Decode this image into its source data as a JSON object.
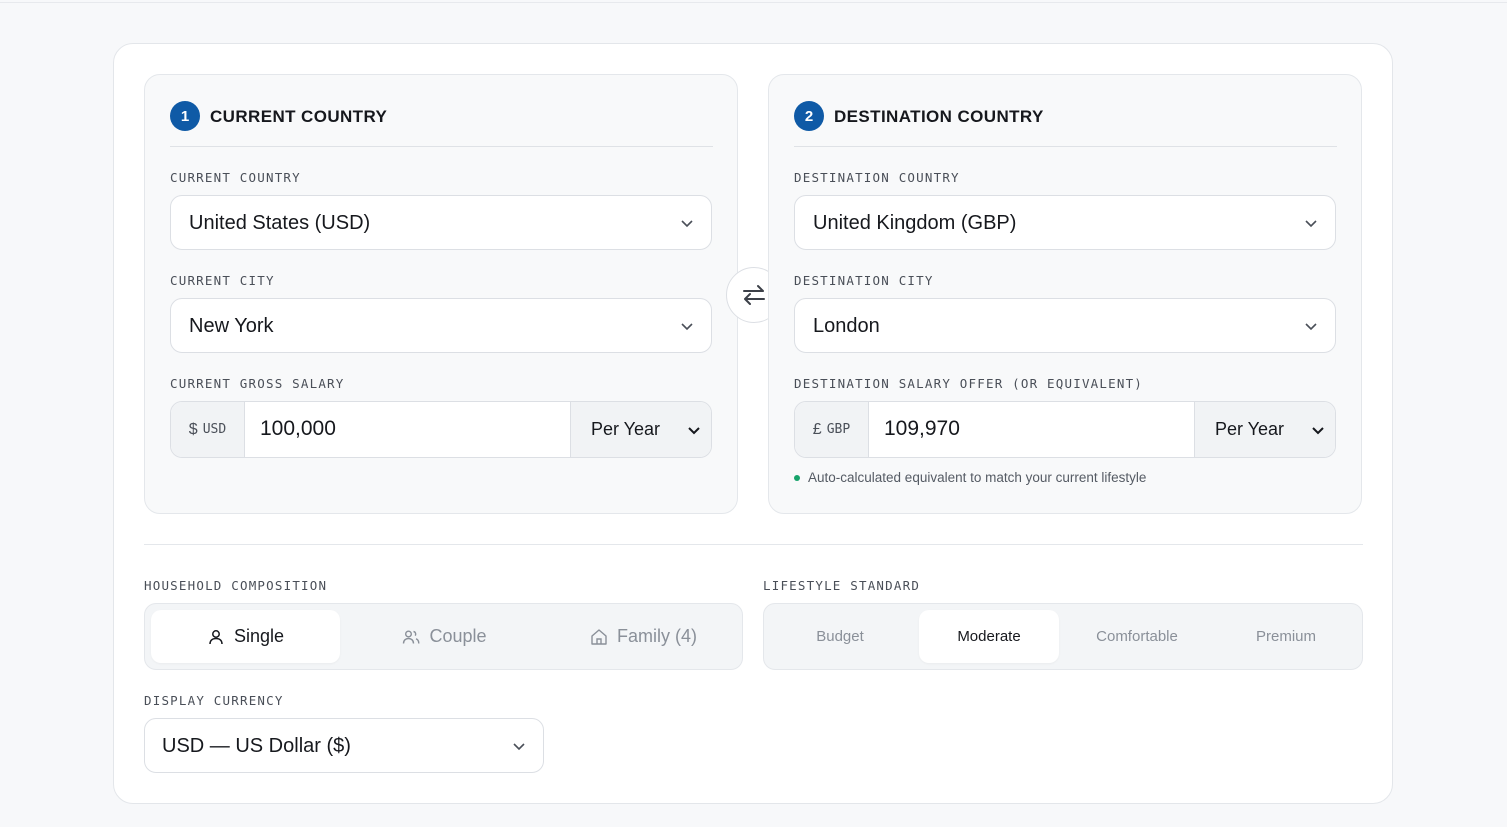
{
  "current": {
    "step": "1",
    "title": "CURRENT COUNTRY",
    "country_label": "CURRENT COUNTRY",
    "country_value": "United States (USD)",
    "city_label": "CURRENT CITY",
    "city_value": "New York",
    "salary_label": "CURRENT GROSS SALARY",
    "currency_symbol": "$",
    "currency_code": "USD",
    "salary_value": "100,000",
    "period": "Per Year"
  },
  "destination": {
    "step": "2",
    "title": "DESTINATION COUNTRY",
    "country_label": "DESTINATION COUNTRY",
    "country_value": "United Kingdom (GBP)",
    "city_label": "DESTINATION CITY",
    "city_value": "London",
    "salary_label": "DESTINATION SALARY OFFER (OR EQUIVALENT)",
    "currency_symbol": "£",
    "currency_code": "GBP",
    "salary_value": "109,970",
    "period": "Per Year",
    "note": "Auto-calculated equivalent to match your current lifestyle"
  },
  "household": {
    "label": "HOUSEHOLD COMPOSITION",
    "options": [
      "Single",
      "Couple",
      "Family (4)"
    ],
    "selected": "Single"
  },
  "lifestyle": {
    "label": "LIFESTYLE STANDARD",
    "options": [
      "Budget",
      "Moderate",
      "Comfortable",
      "Premium"
    ],
    "selected": "Moderate"
  },
  "display_currency": {
    "label": "DISPLAY CURRENCY",
    "value": "USD — US Dollar ($)"
  },
  "icons": {
    "swap": "swap-arrows-icon",
    "single": "user-icon",
    "couple": "users-icon",
    "family": "home-icon",
    "dropdown": "chevron-down-icon"
  },
  "colors": {
    "accent": "#0f5aa6",
    "success_dot": "#16a36a"
  }
}
